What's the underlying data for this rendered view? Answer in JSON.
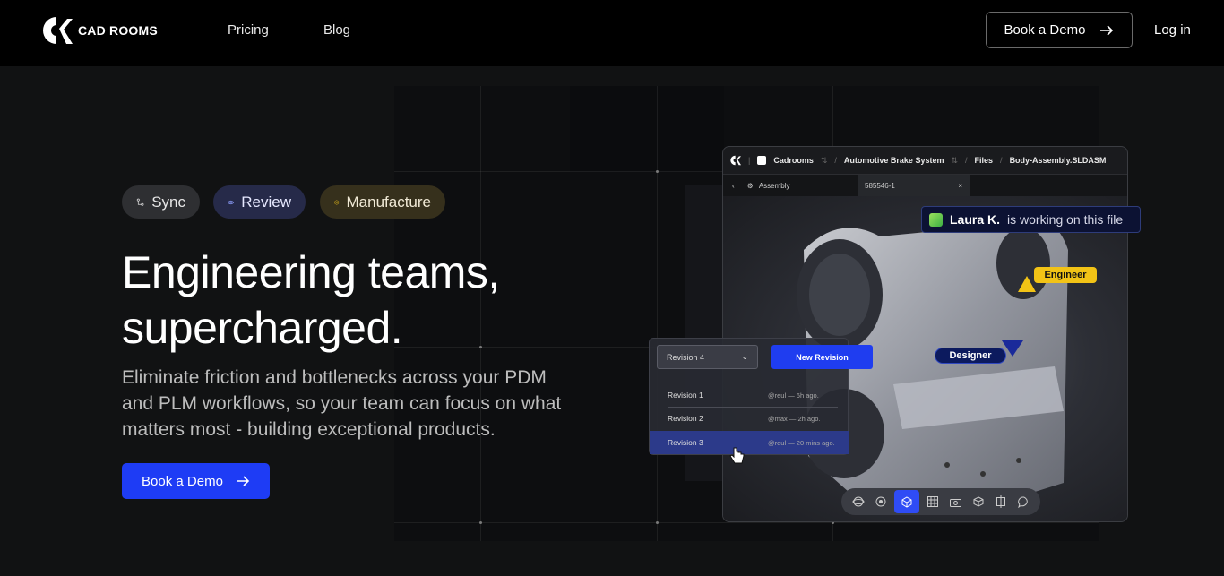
{
  "nav": {
    "brand": "CAD ROOMS",
    "links": [
      "Pricing",
      "Blog"
    ],
    "demo_label": "Book a Demo",
    "login_label": "Log in"
  },
  "hero": {
    "pills": [
      {
        "label": "Sync",
        "icon": "git-branch-icon"
      },
      {
        "label": "Review",
        "icon": "eye-icon"
      },
      {
        "label": "Manufacture",
        "icon": "hexagon-gear-icon"
      }
    ],
    "headline_line1": "Engineering teams,",
    "headline_line2": "supercharged.",
    "subtext": "Eliminate friction and bottlenecks across your PDM and PLM workflows, so your team can focus on what matters most - building exceptional products.",
    "cta_label": "Book a Demo",
    "accent": "#1e3cf5"
  },
  "app": {
    "crumbs": [
      "Cadrooms",
      "Automotive Brake System",
      "Files",
      "Body-Assembly.SLDASM"
    ],
    "sub_label": "Assembly",
    "file_tab": "585546-1",
    "presence_name": "Laura K.",
    "presence_text": "is working on this file",
    "tag_engineer": "Engineer",
    "tag_designer": "Designer",
    "revision_select": "Revision 4",
    "new_revision": "New Revision",
    "revisions": [
      {
        "label": "Revision 1",
        "meta": "@reul — 6h ago."
      },
      {
        "label": "Revision 2",
        "meta": "@max — 2h ago."
      },
      {
        "label": "Revision 3",
        "meta": "@reul — 20 mins ago."
      }
    ],
    "toolbar_icons": [
      "orbit-icon",
      "rotate-icon",
      "cube-view-icon",
      "grid-icon",
      "camera-icon",
      "box-icon",
      "section-icon",
      "comment-icon"
    ]
  }
}
